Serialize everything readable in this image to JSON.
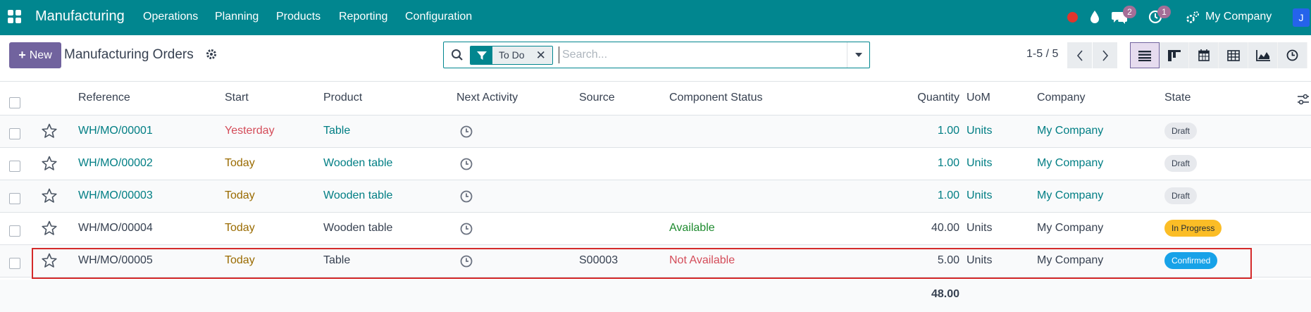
{
  "navbar": {
    "brand": "Manufacturing",
    "menus": [
      "Operations",
      "Planning",
      "Products",
      "Reporting",
      "Configuration"
    ],
    "messages_count": "2",
    "activities_count": "1",
    "company": "My Company",
    "avatar_initial": "J"
  },
  "control_panel": {
    "new_label": "New",
    "title": "Manufacturing Orders",
    "facet_label": "To Do",
    "search_placeholder": "Search...",
    "pager": "1-5 / 5"
  },
  "columns": [
    "Reference",
    "Start",
    "Product",
    "Next Activity",
    "Source",
    "Component Status",
    "Quantity",
    "UoM",
    "Company",
    "State"
  ],
  "rows": [
    {
      "reference": "WH/MO/00001",
      "start": "Yesterday",
      "product": "Table",
      "source": "",
      "component_status": "",
      "quantity": "1.00",
      "uom": "Units",
      "company": "My Company",
      "state": "Draft"
    },
    {
      "reference": "WH/MO/00002",
      "start": "Today",
      "product": "Wooden table",
      "source": "",
      "component_status": "",
      "quantity": "1.00",
      "uom": "Units",
      "company": "My Company",
      "state": "Draft"
    },
    {
      "reference": "WH/MO/00003",
      "start": "Today",
      "product": "Wooden table",
      "source": "",
      "component_status": "",
      "quantity": "1.00",
      "uom": "Units",
      "company": "My Company",
      "state": "Draft"
    },
    {
      "reference": "WH/MO/00004",
      "start": "Today",
      "product": "Wooden table",
      "source": "",
      "component_status": "Available",
      "quantity": "40.00",
      "uom": "Units",
      "company": "My Company",
      "state": "In Progress"
    },
    {
      "reference": "WH/MO/00005",
      "start": "Today",
      "product": "Table",
      "source": "S00003",
      "component_status": "Not Available",
      "quantity": "5.00",
      "uom": "Units",
      "company": "My Company",
      "state": "Confirmed"
    }
  ],
  "footer": {
    "total_quantity": "48.00"
  },
  "colors": {
    "navbar": "#01868f",
    "primary": "#71639e",
    "link": "#017e84",
    "highlight": "#d42a2a"
  }
}
